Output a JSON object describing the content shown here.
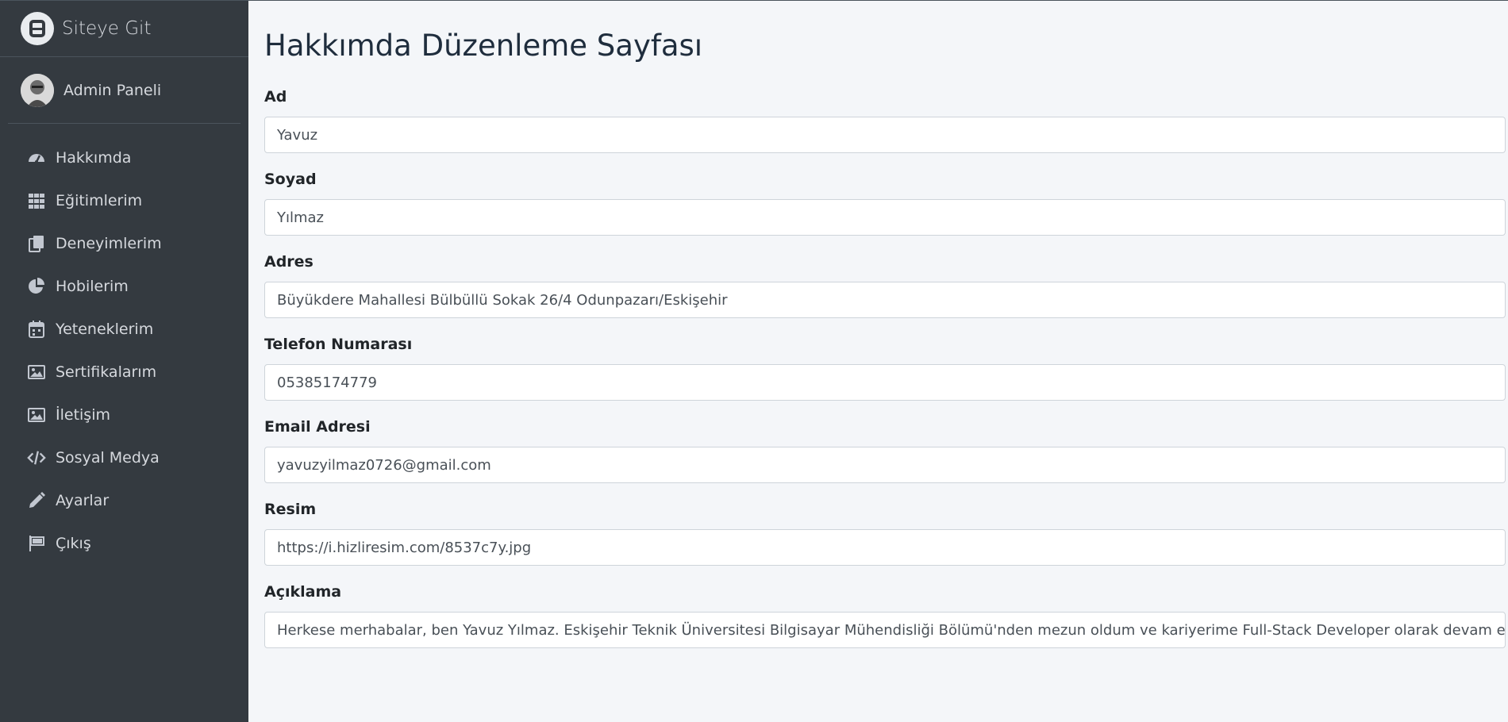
{
  "brand": {
    "title": "Siteye Git",
    "logo_icon": "brand-logo-icon"
  },
  "user": {
    "name": "Admin Paneli",
    "avatar_icon": "user-avatar"
  },
  "sidebar": {
    "items": [
      {
        "label": "Hakkımda",
        "icon": "tachometer-icon"
      },
      {
        "label": "Eğitimlerim",
        "icon": "grid-icon"
      },
      {
        "label": "Deneyimlerim",
        "icon": "copy-icon"
      },
      {
        "label": "Hobilerim",
        "icon": "pie-chart-icon"
      },
      {
        "label": "Yeteneklerim",
        "icon": "calendar-icon"
      },
      {
        "label": "Sertifikalarım",
        "icon": "image-icon"
      },
      {
        "label": "İletişim",
        "icon": "image-icon"
      },
      {
        "label": "Sosyal Medya",
        "icon": "code-icon"
      },
      {
        "label": "Ayarlar",
        "icon": "pencil-icon"
      },
      {
        "label": "Çıkış",
        "icon": "flag-icon"
      }
    ]
  },
  "page": {
    "title": "Hakkımda Düzenleme Sayfası"
  },
  "form": {
    "fields": [
      {
        "label": "Ad",
        "value": "Yavuz"
      },
      {
        "label": "Soyad",
        "value": "Yılmaz"
      },
      {
        "label": "Adres",
        "value": "Büyükdere Mahallesi Bülbüllü Sokak 26/4 Odunpazarı/Eskişehir"
      },
      {
        "label": "Telefon Numarası",
        "value": "05385174779"
      },
      {
        "label": "Email Adresi",
        "value": "yavuzyilmaz0726@gmail.com"
      },
      {
        "label": "Resim",
        "value": "https://i.hizliresim.com/8537c7y.jpg"
      },
      {
        "label": "Açıklama",
        "value": "Herkese merhabalar, ben Yavuz Yılmaz. Eskişehir Teknik Üniversitesi Bilgisayar Mühendisliği Bölümü'nden mezun oldum ve kariyerime Full-Stack Developer olarak devam etmek"
      }
    ]
  },
  "colors": {
    "sidebar_bg": "#343a40",
    "page_bg": "#f4f6f9"
  }
}
